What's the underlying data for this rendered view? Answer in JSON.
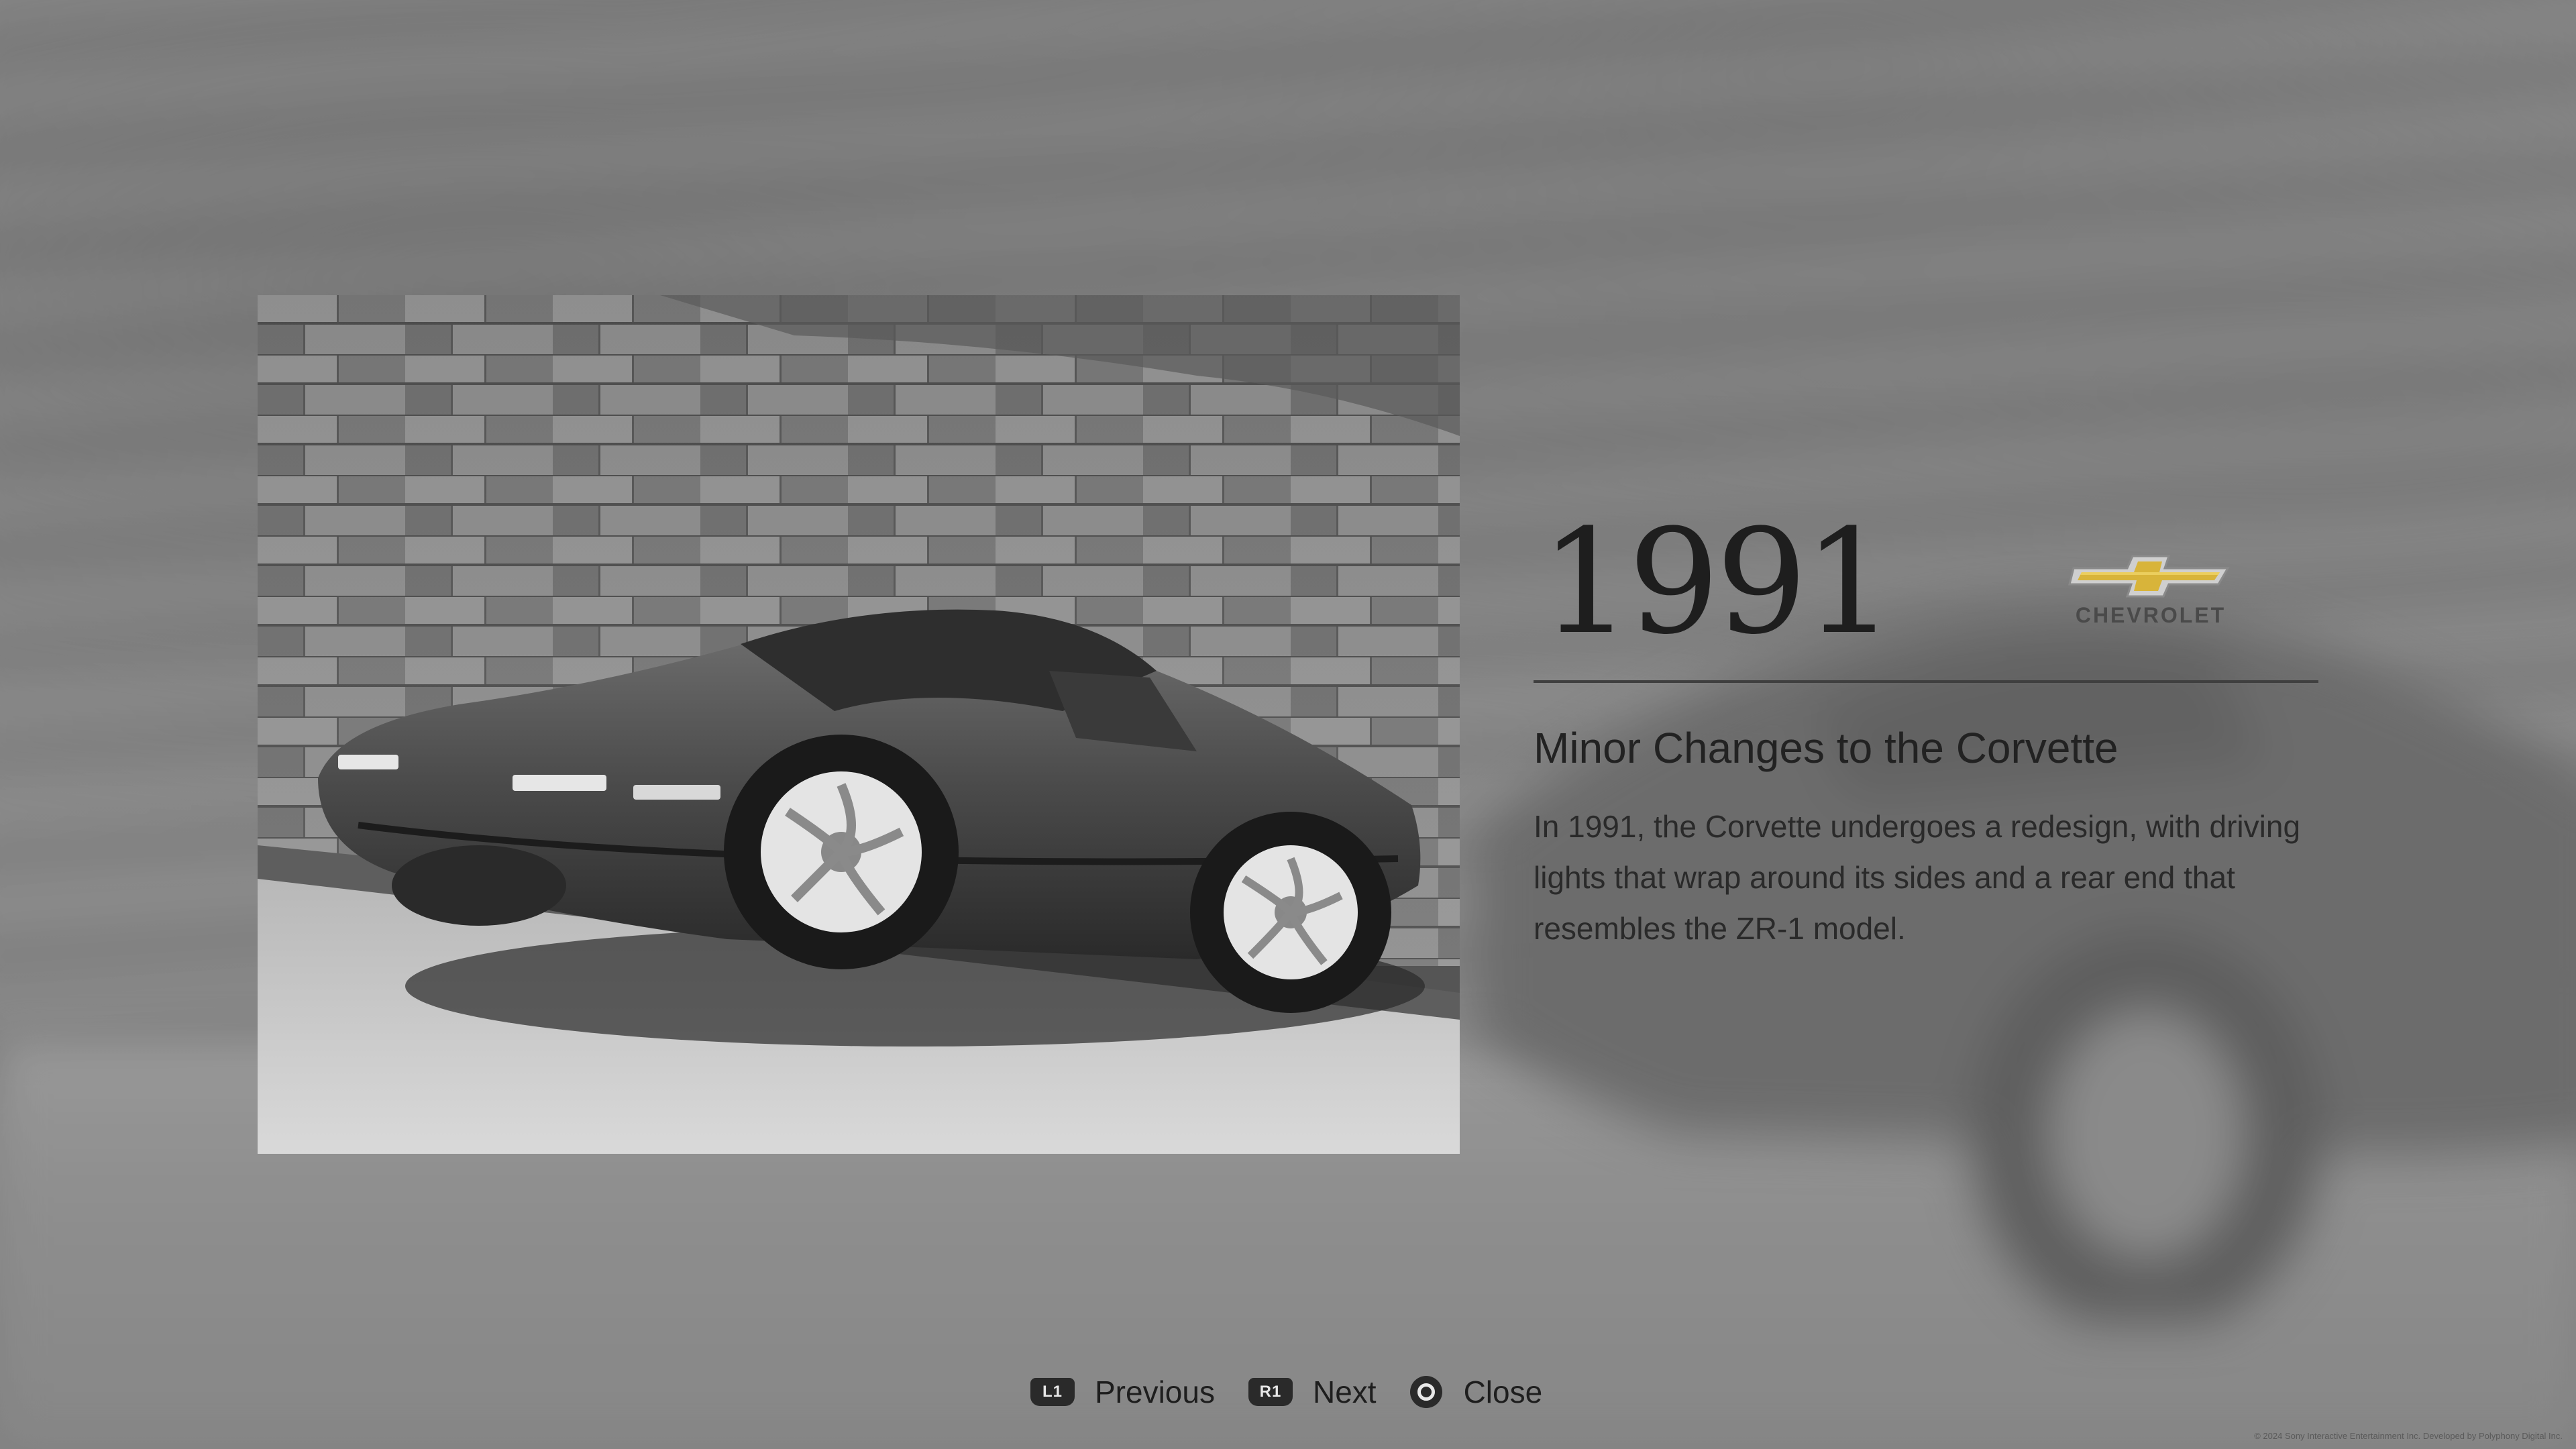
{
  "entry": {
    "year": "1991",
    "brand": "CHEVROLET",
    "headline": "Minor Changes to the Corvette",
    "description": "In 1991, the Corvette undergoes a redesign, with driving lights that wrap around its sides and a rear end that resembles the ZR-1 model.",
    "photo_icon": "corvette-photo",
    "logo_icon": "chevrolet-bowtie-icon",
    "logo_color": "#d8b43a"
  },
  "controls": {
    "previous": {
      "button": "L1",
      "label": "Previous"
    },
    "next": {
      "button": "R1",
      "label": "Next"
    },
    "close": {
      "button_icon": "circle-button-icon",
      "label": "Close"
    }
  },
  "footer": {
    "copyright": "© 2024 Sony Interactive Entertainment Inc. Developed by Polyphony Digital Inc."
  }
}
